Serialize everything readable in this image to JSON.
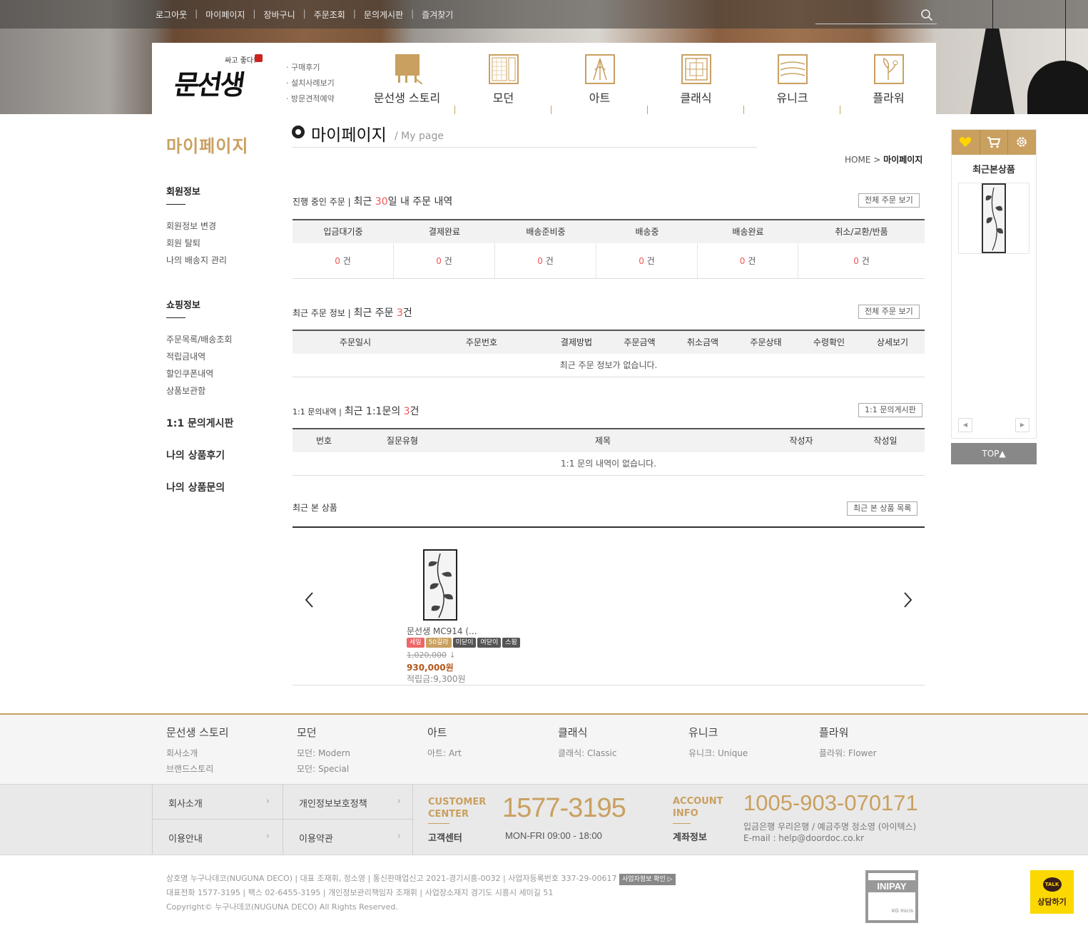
{
  "topnav": [
    "로그아웃",
    "마이페이지",
    "장바구니",
    "주문조회",
    "문의게시판",
    "즐겨찾기"
  ],
  "logo": {
    "tagline": "싸고 좋다!",
    "name": "문선생",
    "stamp": "印"
  },
  "sublinks": [
    "· 구매후기",
    "· 설치사례보기",
    "· 방문견적예약"
  ],
  "categories": [
    "문선생 스토리",
    "모던",
    "아트",
    "클래식",
    "유니크",
    "플라워"
  ],
  "sidebar": {
    "title": "마이페이지",
    "member_title": "회원정보",
    "member_links": [
      "회원정보 변경",
      "회원 탈퇴",
      "나의 배송지 관리"
    ],
    "shop_title": "쇼핑정보",
    "shop_links": [
      "주문목록/배송조회",
      "적립금내역",
      "할인쿠폰내역",
      "상품보관함"
    ],
    "extra": [
      "1:1 문의게시판",
      "나의 상품후기",
      "나의 상품문의"
    ]
  },
  "page": {
    "title": "마이페이지",
    "subtitle": "/ My page",
    "breadcrumb_home": "HOME",
    "breadcrumb_sep": ">",
    "breadcrumb_current": "마이페이지"
  },
  "progress": {
    "label": "진행 중인 주문 |",
    "recent_pre": "최근 ",
    "days": "30",
    "recent_post": "일 내 주문 내역",
    "button": "전체 주문 보기",
    "headers": [
      "입금대기중",
      "결제완료",
      "배송준비중",
      "배송중",
      "배송완료",
      "취소/교환/반품"
    ],
    "counts": [
      "0",
      "0",
      "0",
      "0",
      "0",
      "0"
    ],
    "unit": "건"
  },
  "recent_orders": {
    "label": "최근 주문 정보 |",
    "recent_pre": "최근 주문 ",
    "count": "3",
    "recent_post": "건",
    "button": "전체 주문 보기",
    "headers": [
      "주문일시",
      "주문번호",
      "결제방법",
      "주문금액",
      "취소금액",
      "주문상태",
      "수령확인",
      "상세보기"
    ],
    "empty": "최근 주문 정보가 없습니다."
  },
  "inquiries": {
    "label": "1:1 문의내역 |",
    "recent_pre": "최근 1:1문의 ",
    "count": "3",
    "recent_post": "건",
    "button": "1:1 문의게시판",
    "headers": [
      "번호",
      "질문유형",
      "제목",
      "작성자",
      "작성일"
    ],
    "empty": "1:1 문의 내역이 없습니다."
  },
  "viewed": {
    "label": "최근 본 상품",
    "button": "최근 본 상품 목록",
    "product": {
      "name": "문선생 MC914 (...",
      "badges": [
        "세일",
        "50길라",
        "미닫이",
        "여닫이",
        "스윙"
      ],
      "old_price": "1,020,000",
      "arrow": "↓",
      "price": "930,000원",
      "points": "적립금:9,300원"
    }
  },
  "rightpanel": {
    "title": "최근본상품",
    "prev": "◀",
    "next": "▶",
    "top": "TOP▲"
  },
  "footer": {
    "cols": [
      {
        "h": "문선생 스토리",
        "links": [
          "회사소개",
          "브랜드스토리"
        ]
      },
      {
        "h": "모던",
        "links": [
          "모던: Modern",
          "모던: Special"
        ]
      },
      {
        "h": "아트",
        "links": [
          "아트: Art"
        ]
      },
      {
        "h": "클래식",
        "links": [
          "클래식: Classic"
        ]
      },
      {
        "h": "유니크",
        "links": [
          "유니크: Unique"
        ]
      },
      {
        "h": "플라워",
        "links": [
          "플라워: Flower"
        ]
      }
    ],
    "links": [
      "회사소개",
      "개인정보보호정책",
      "이용안내",
      "이용약관"
    ],
    "cc_label1": "CUSTOMER",
    "cc_label2": "CENTER",
    "cc_sub": "고객센터",
    "phone": "1577-3195",
    "hours": "MON-FRI 09:00 - 18:00",
    "acc_label1": "ACCOUNT",
    "acc_label2": "INFO",
    "acc_sub": "계좌정보",
    "account": "1005-903-070171",
    "bank": "입금은행 우리은행 / 예금주명 정소영 (아이텍스)",
    "email": "E-mail : help@doordoc.co.kr",
    "line1": "상호명 누구나데코(NUGUNA DECO) | 대표 조재휘, 정소영 | 통신판매업신고 2021-경기시흥-0032 | 사업자등록번호 337-29-00617",
    "bizbtn": "사업자정보 확인 ▷",
    "line2": "대표전화 1577-3195 | 팩스 02-6455-3195 | 개인정보관리책임자 조재휘 | 사업장소재지 경기도 시흥시 세미길 51",
    "line3": "Copyright© 누구나데코(NUGUNA DECO) All Rights Reserved.",
    "inipay": "INIPAY",
    "kg": "KG Inicis",
    "talk": "TALK",
    "talk_label": "상담하기"
  },
  "colors": {
    "accent": "#c9a060",
    "red": "#e55555"
  }
}
